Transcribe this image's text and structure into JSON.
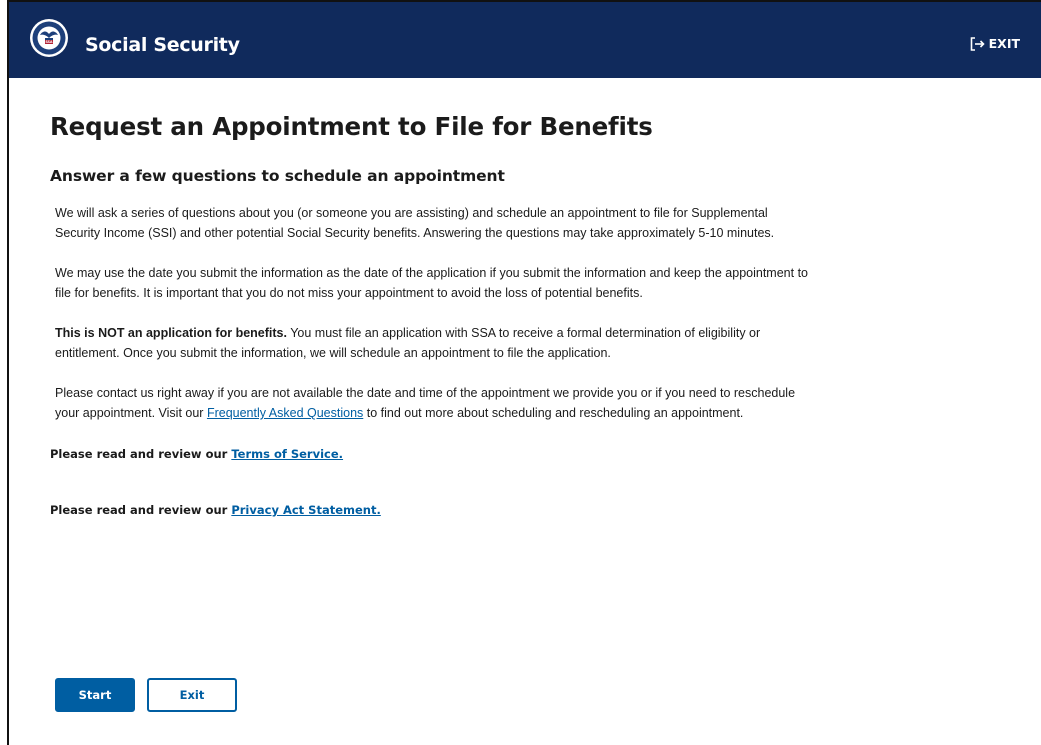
{
  "header": {
    "brand": "Social Security",
    "exit_label": "EXIT",
    "logo_icon": "ssa-seal-icon",
    "exit_icon": "sign-out-icon",
    "background_color": "#102a5c"
  },
  "main": {
    "title": "Request an Appointment to File for Benefits",
    "subtitle": "Answer a few questions to schedule an appointment",
    "paragraphs": [
      "We will ask a series of questions about you (or someone you are assisting) and schedule an appointment to file for Supplemental Security Income (SSI) and other potential Social Security benefits.  Answering the questions may take approximately 5-10 minutes.",
      "We may use the date you submit the information as the date of the application if you submit the information and keep the appointment to file for benefits. It is important that you do not miss your appointment to avoid the loss of potential benefits."
    ],
    "notice": {
      "bold": "This is NOT an application for benefits.",
      "rest": " You must file an application with SSA to receive a formal determination of eligibility or entitlement. Once you submit the information, we will schedule an appointment to file the application."
    },
    "contact": {
      "before": "Please contact us right away if you are not available the date and time of the appointment we provide you or if you need to reschedule your appointment. Visit our ",
      "link": "Frequently Asked Questions",
      "after": " to find out more about scheduling and rescheduling an appointment."
    },
    "terms": {
      "prefix": "Please read and review our ",
      "link": "Terms of Service."
    },
    "privacy": {
      "prefix": "Please read and review our ",
      "link": "Privacy Act Statement."
    }
  },
  "buttons": {
    "start": "Start",
    "exit": "Exit"
  },
  "colors": {
    "accent": "#005ea2",
    "text": "#1b1b1b"
  }
}
